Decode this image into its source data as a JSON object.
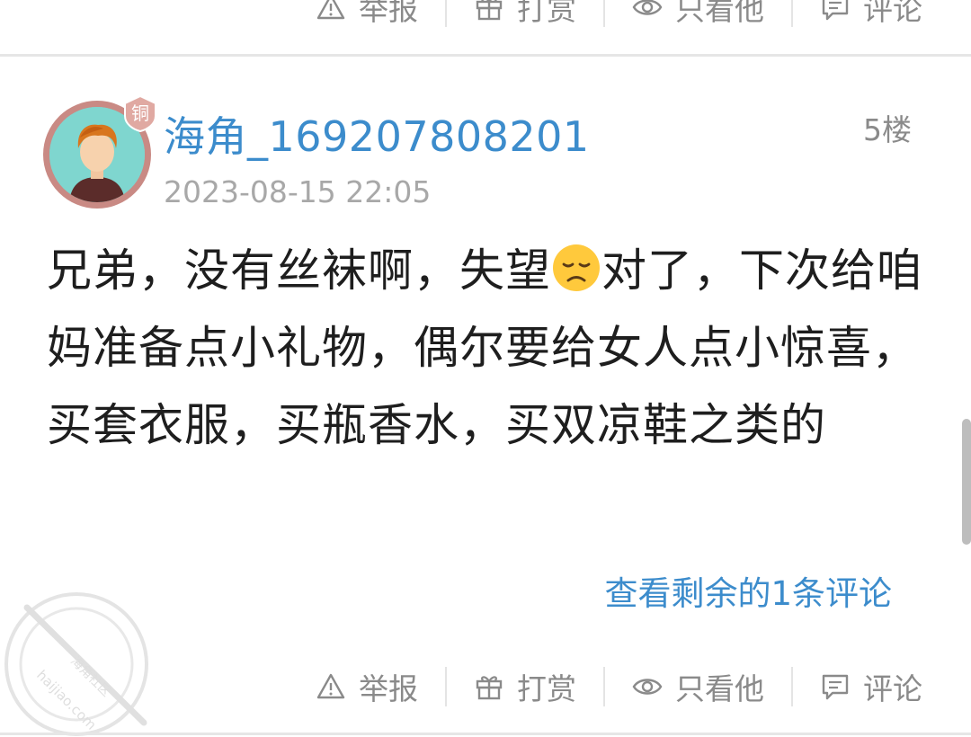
{
  "actions": {
    "report": "举报",
    "reward": "打赏",
    "only_author": "只看他",
    "comment": "评论"
  },
  "post": {
    "username": "海角_169207808201",
    "badge": "铜",
    "timestamp": "2023-08-15 22:05",
    "floor": "5楼",
    "content_part1": "兄弟，没有丝袜啊，失望",
    "emoji": "disappointed-face-emoji",
    "content_part2": "对了，下次给咱妈准备点小礼物，偶尔要给女人点小惊喜，买套衣服，买瓶香水，买双凉鞋之类的",
    "more_comments": "查看剩余的1条评论"
  },
  "watermark": {
    "line1": "海角社区",
    "line2": "haijiao.com"
  },
  "colors": {
    "link": "#3c8ccc",
    "muted": "#8a8a8a",
    "badge": "#e0a9a2"
  }
}
